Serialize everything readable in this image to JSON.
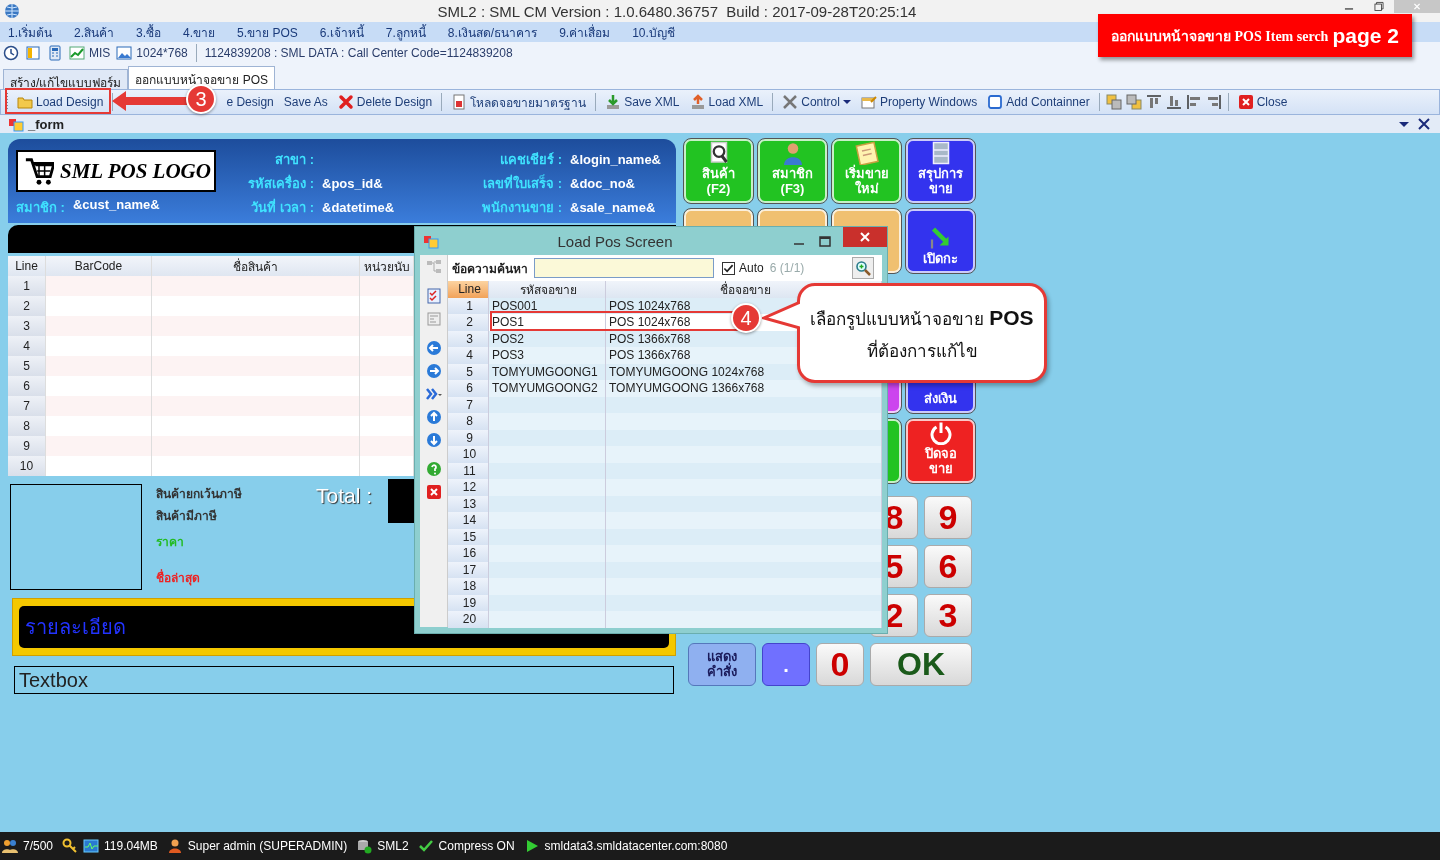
{
  "window": {
    "title": "SML2 : SML CM Version : 1.0.6480.36757  Build : 2017-09-28T20:25:14"
  },
  "menu": [
    "1.เริ่มต้น",
    "2.สินค้า",
    "3.ซื้อ",
    "4.ขาย",
    "5.ขาย POS",
    "6.เจ้าหนี้",
    "7.ลูกหนี้",
    "8.เงินสด/ธนาคาร",
    "9.ค่าเสื่อม",
    "10.บัญชี"
  ],
  "quick_bar": {
    "mis": "MIS",
    "resolution": "1024*768",
    "info": "1124839208 : SML DATA : Call Center Code=1124839208"
  },
  "tabs": [
    {
      "label": "สร้าง/แก้ไขแบบฟอร์ม",
      "selected": false
    },
    {
      "label": "ออกแบบหน้าจอขาย POS",
      "selected": true
    }
  ],
  "toolbar": [
    {
      "kind": "button",
      "label": "Load Design"
    },
    {
      "kind": "separator"
    },
    {
      "kind": "button",
      "label": "e Design"
    },
    {
      "kind": "button",
      "label": "Save As"
    },
    {
      "kind": "button",
      "label": "Delete Design"
    },
    {
      "kind": "separator"
    },
    {
      "kind": "button",
      "label": "โหลดจอขายมาตรฐาน"
    },
    {
      "kind": "separator"
    },
    {
      "kind": "button",
      "label": "Save XML"
    },
    {
      "kind": "button",
      "label": "Load XML"
    },
    {
      "kind": "separator"
    },
    {
      "kind": "dropdown",
      "label": "Control"
    },
    {
      "kind": "button",
      "label": "Property Windows"
    },
    {
      "kind": "button",
      "label": "Add Containner"
    },
    {
      "kind": "separator"
    },
    {
      "kind": "icon"
    },
    {
      "kind": "icon"
    },
    {
      "kind": "icon"
    },
    {
      "kind": "icon"
    },
    {
      "kind": "icon"
    },
    {
      "kind": "icon"
    },
    {
      "kind": "separator"
    },
    {
      "kind": "button",
      "label": "Close"
    }
  ],
  "form_panel": {
    "title": "_form"
  },
  "pos_header": {
    "logo": "SML POS LOGO",
    "member": {
      "label": "สมาชิก :",
      "value": "&cust_name&"
    },
    "columns": [
      [
        {
          "label": "สาขา :"
        },
        {
          "label": "รหัสเครื่อง :",
          "value": "&pos_id&"
        },
        {
          "label": "วันที่ เวลา :",
          "value": "&datetime&"
        }
      ],
      [
        {
          "label": "แคชเชียร์ :",
          "value": "&login_name&"
        },
        {
          "label": "เลขที่ใบเสร็จ :",
          "value": "&doc_no&"
        },
        {
          "label": "พนักงานขาย :",
          "value": "&sale_name&"
        }
      ]
    ]
  },
  "sale_grid": {
    "columns": [
      "Line",
      "BarCode",
      "ชื่อสินค้า",
      "หน่วยนับ"
    ],
    "rows": [
      "1",
      "2",
      "3",
      "4",
      "5",
      "6",
      "7",
      "8",
      "9",
      "10"
    ]
  },
  "summary": {
    "labels": [
      {
        "text": "สินค้ายกเว้นภาษี",
        "color": "#333333"
      },
      {
        "text": "สินค้ามีภาษี",
        "color": "#333333"
      },
      {
        "text": "ราคา",
        "color": "#22bb22"
      },
      {
        "text": "ชื่อล่าสุด",
        "color": "#ee2222"
      }
    ],
    "total_label": "Total :"
  },
  "detail_label": "รายละเอียด",
  "textbox": "Textbox",
  "function_buttons": [
    {
      "buttons": [
        {
          "label": "สินค้า\n(F2)",
          "color": "#22c322"
        },
        {
          "label": "สมาชิก\n(F3)",
          "color": "#22c322"
        },
        {
          "label": "เริ่มขาย\nใหม่",
          "color": "#22c322"
        },
        {
          "label": "สรุปการ\nขาย",
          "color": "#3333ee"
        }
      ]
    },
    {
      "buttons": [
        {
          "color": "#f0c070"
        },
        {
          "color": "#f0c070"
        },
        {
          "color": "#f0c070"
        },
        {
          "label": "เปิดกะ",
          "color": "#3333ee"
        }
      ]
    },
    {
      "buttons": [
        {
          "color": "#cc44ee"
        },
        {
          "label": "ส่งเงิน",
          "color": "#3333ee"
        }
      ]
    },
    {
      "buttons": [
        {
          "color": "#22c322"
        },
        {
          "label": "ปิดจอ\nขาย",
          "color": "#ee2222"
        }
      ]
    }
  ],
  "keypad": [
    {
      "keys": [
        {
          "kind": "digit",
          "label": "8"
        },
        {
          "kind": "digit",
          "label": "9"
        }
      ]
    },
    {
      "keys": [
        {
          "kind": "digit",
          "label": "5"
        },
        {
          "kind": "digit",
          "label": "6"
        }
      ]
    },
    {
      "keys": [
        {
          "kind": "digit",
          "label": "2"
        },
        {
          "kind": "digit",
          "label": "3"
        }
      ]
    },
    {
      "keys": [
        {
          "kind": "command",
          "label": "แสดง\nคำสั่ง"
        },
        {
          "kind": "dot",
          "label": "."
        },
        {
          "kind": "digit",
          "label": "0"
        },
        {
          "kind": "ok",
          "label": "OK"
        }
      ]
    }
  ],
  "dialog": {
    "title": "Load Pos Screen",
    "search_label": "ข้อความค้นหา",
    "auto": {
      "label": "Auto",
      "checked": true
    },
    "count": "6 (1/1)",
    "columns": [
      "Line",
      "รหัสจอขาย",
      "ชื่อจอขาย"
    ],
    "rows": [
      {
        "line": "1",
        "code": "POS001",
        "name": "POS 1024x768",
        "selected": false
      },
      {
        "line": "2",
        "code": "POS1",
        "name": "POS 1024x768",
        "selected": true
      },
      {
        "line": "3",
        "code": "POS2",
        "name": "POS 1366x768",
        "selected": false
      },
      {
        "line": "4",
        "code": "POS3",
        "name": "POS 1366x768",
        "selected": false
      },
      {
        "line": "5",
        "code": "TOMYUMGOONG1",
        "name": "TOMYUMGOONG 1024x768",
        "selected": false
      },
      {
        "line": "6",
        "code": "TOMYUMGOONG2",
        "name": "TOMYUMGOONG 1366x768",
        "selected": false
      },
      {
        "line": "7",
        "selected": false
      },
      {
        "line": "8",
        "selected": false
      },
      {
        "line": "9",
        "selected": false
      },
      {
        "line": "10",
        "selected": false
      },
      {
        "line": "11",
        "selected": false
      },
      {
        "line": "12",
        "selected": false
      },
      {
        "line": "13",
        "selected": false
      },
      {
        "line": "14",
        "selected": false
      },
      {
        "line": "15",
        "selected": false
      },
      {
        "line": "16",
        "selected": false
      },
      {
        "line": "17",
        "selected": false
      },
      {
        "line": "18",
        "selected": false
      },
      {
        "line": "19",
        "selected": false
      },
      {
        "line": "20",
        "selected": false
      }
    ]
  },
  "annotations": {
    "banner": "ออกแบบหน้าจอขาย POS Item serch **page 2**",
    "step_3": "3",
    "step_4": "4",
    "callout": [
      "เลือกรูปแบบหน้าจอขาย **POS**",
      "ที่ต้องการแก้ไข"
    ]
  },
  "status_bar": [
    "7/500",
    "119.04MB",
    "Super admin (SUPERADMIN)",
    "SML2",
    "Compress ON",
    "smldata3.smldatacenter.com:8080"
  ]
}
